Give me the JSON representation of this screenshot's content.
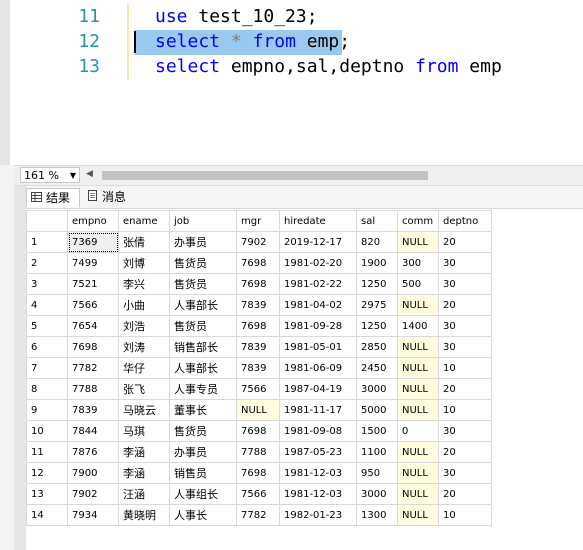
{
  "editor": {
    "lines": [
      {
        "num": "11",
        "tokens": [
          {
            "t": "use",
            "kw": true
          },
          {
            "t": " test_10_23;",
            "kw": false
          }
        ]
      },
      {
        "num": "12",
        "tokens": [
          {
            "t": "select",
            "kw": true
          },
          {
            "t": " ",
            "kw": false
          },
          {
            "t": "*",
            "op": true
          },
          {
            "t": " ",
            "kw": false
          },
          {
            "t": "from",
            "kw": true
          },
          {
            "t": " emp;",
            "kw": false
          }
        ]
      },
      {
        "num": "13",
        "tokens": [
          {
            "t": "select",
            "kw": true
          },
          {
            "t": " empno,sal,deptno ",
            "kw": false
          },
          {
            "t": "from",
            "kw": true
          },
          {
            "t": " emp",
            "kw": false
          }
        ]
      }
    ],
    "keyword_color": "#0000ff",
    "selection_color": "#99c9ef"
  },
  "zoom": {
    "value": "161 %"
  },
  "tabs": {
    "results": "结果",
    "messages": "消息"
  },
  "grid": {
    "columns": [
      "empno",
      "ename",
      "job",
      "mgr",
      "hiredate",
      "sal",
      "comm",
      "deptno"
    ],
    "null_text": "NULL",
    "rows": [
      {
        "n": "1",
        "cells": [
          "7369",
          "张倩",
          "办事员",
          "7902",
          "2019-12-17",
          "820",
          null,
          "20"
        ]
      },
      {
        "n": "2",
        "cells": [
          "7499",
          "刘博",
          "售货员",
          "7698",
          "1981-02-20",
          "1900",
          "300",
          "30"
        ]
      },
      {
        "n": "3",
        "cells": [
          "7521",
          "李兴",
          "售货员",
          "7698",
          "1981-02-22",
          "1250",
          "500",
          "30"
        ]
      },
      {
        "n": "4",
        "cells": [
          "7566",
          "小曲",
          "人事部长",
          "7839",
          "1981-04-02",
          "2975",
          null,
          "20"
        ]
      },
      {
        "n": "5",
        "cells": [
          "7654",
          "刘浩",
          "售货员",
          "7698",
          "1981-09-28",
          "1250",
          "1400",
          "30"
        ]
      },
      {
        "n": "6",
        "cells": [
          "7698",
          "刘涛",
          "销售部长",
          "7839",
          "1981-05-01",
          "2850",
          null,
          "30"
        ]
      },
      {
        "n": "7",
        "cells": [
          "7782",
          "华仔",
          "人事部长",
          "7839",
          "1981-06-09",
          "2450",
          null,
          "10"
        ]
      },
      {
        "n": "8",
        "cells": [
          "7788",
          "张飞",
          "人事专员",
          "7566",
          "1987-04-19",
          "3000",
          null,
          "20"
        ]
      },
      {
        "n": "9",
        "cells": [
          "7839",
          "马晓云",
          "董事长",
          null,
          "1981-11-17",
          "5000",
          null,
          "10"
        ]
      },
      {
        "n": "10",
        "cells": [
          "7844",
          "马琪",
          "售货员",
          "7698",
          "1981-09-08",
          "1500",
          "0",
          "30"
        ]
      },
      {
        "n": "11",
        "cells": [
          "7876",
          "李涵",
          "办事员",
          "7788",
          "1987-05-23",
          "1100",
          null,
          "20"
        ]
      },
      {
        "n": "12",
        "cells": [
          "7900",
          "李涵",
          "销售员",
          "7698",
          "1981-12-03",
          "950",
          null,
          "30"
        ]
      },
      {
        "n": "13",
        "cells": [
          "7902",
          "汪涵",
          "人事组长",
          "7566",
          "1981-12-03",
          "3000",
          null,
          "20"
        ]
      },
      {
        "n": "14",
        "cells": [
          "7934",
          "黄晓明",
          "人事长",
          "7782",
          "1982-01-23",
          "1300",
          null,
          "10"
        ]
      }
    ],
    "null_color": "#fffce0"
  }
}
